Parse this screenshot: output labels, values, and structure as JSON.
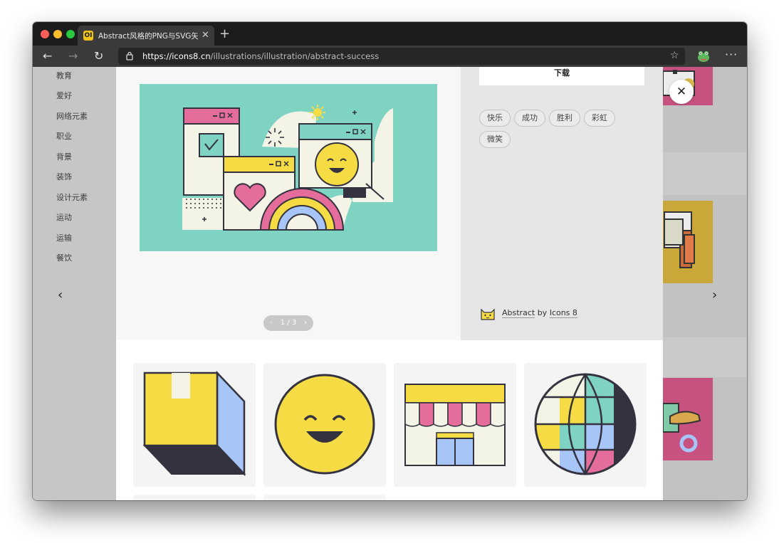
{
  "browser": {
    "tab_title": "Abstract风格的PNG与SVG矢量",
    "favicon": "OI",
    "url_host": "https://icons8.cn",
    "url_path": "/illustrations/illustration/abstract-success"
  },
  "sidebar": {
    "categories": [
      "教育",
      "爱好",
      "网络元素",
      "职业",
      "背景",
      "装饰",
      "设计元素",
      "运动",
      "运输",
      "餐饮"
    ]
  },
  "detail": {
    "download_label": "下载",
    "tags": [
      "快乐",
      "成功",
      "胜利",
      "彩虹",
      "微笑"
    ],
    "author_prefix": "Abstract",
    "author_by": "by",
    "author_name": "Icons 8",
    "pager": "1 / 3"
  },
  "icons": {
    "close": "close-icon",
    "prev": "chevron-left-icon",
    "next": "chevron-right-icon"
  },
  "colors": {
    "teal": "#7fd3c3",
    "pink": "#e56d9b",
    "yellow": "#f5dc45",
    "blue": "#a7c6f7",
    "cream": "#f3f4e6",
    "dark": "#33323e"
  }
}
